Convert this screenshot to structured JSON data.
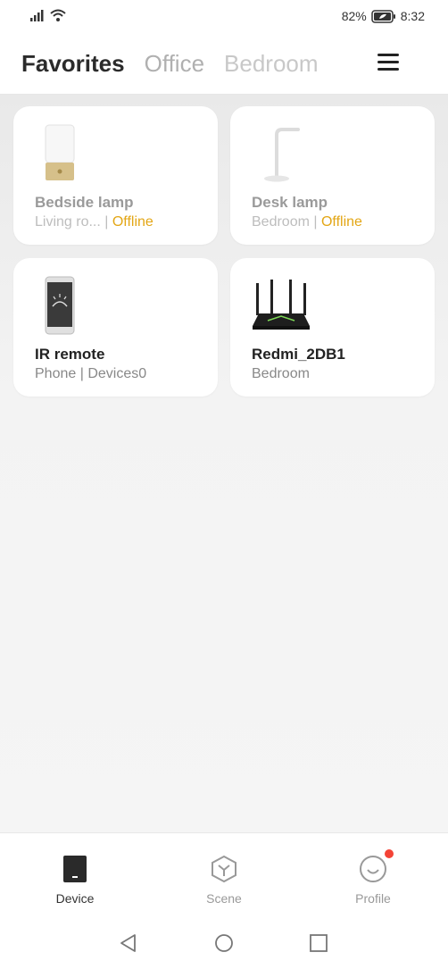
{
  "status_bar": {
    "battery": "82%",
    "time": "8:32"
  },
  "header": {
    "tabs": [
      {
        "label": "Favorites",
        "active": true
      },
      {
        "label": "Office",
        "active": false
      },
      {
        "label": "Bedroom",
        "active": false
      }
    ]
  },
  "devices": [
    {
      "name": "Bedside lamp",
      "location": "Living ro...",
      "status": "Offline",
      "icon": "bedside-lamp-icon"
    },
    {
      "name": "Desk lamp",
      "location": "Bedroom",
      "status": "Offline",
      "icon": "desk-lamp-icon"
    },
    {
      "name": "IR remote",
      "location": "Phone | Devices0",
      "status": "",
      "icon": "phone-ir-remote-icon"
    },
    {
      "name": "Redmi_2DB1",
      "location": "Bedroom",
      "status": "",
      "icon": "router-icon"
    }
  ],
  "bottom_nav": [
    {
      "label": "Device",
      "icon": "device-icon",
      "active": true
    },
    {
      "label": "Scene",
      "icon": "scene-icon",
      "active": false
    },
    {
      "label": "Profile",
      "icon": "profile-icon",
      "active": false,
      "badge": true
    }
  ],
  "colors": {
    "offline": "#e3a615",
    "badge": "#f44336"
  }
}
